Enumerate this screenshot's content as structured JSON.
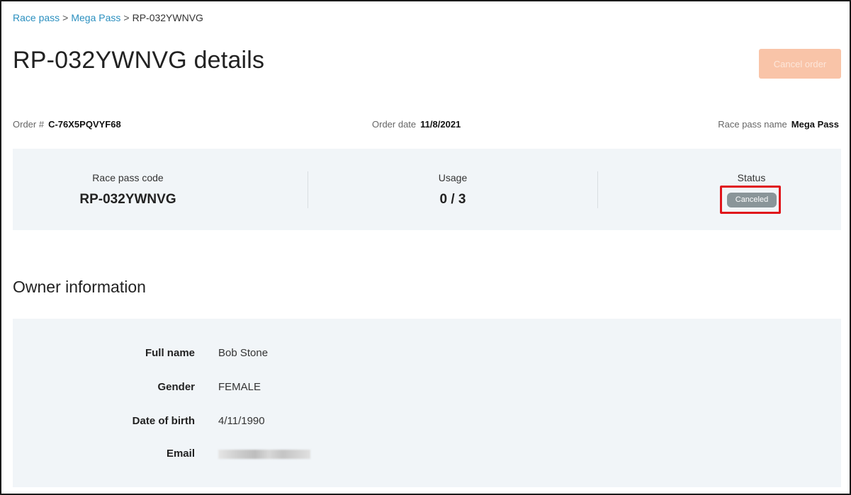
{
  "breadcrumb": {
    "items": [
      "Race pass",
      "Mega Pass"
    ],
    "current": "RP-032YWNVG",
    "separator": ">"
  },
  "page": {
    "title": "RP-032YWNVG details",
    "cancel_button": "Cancel order"
  },
  "meta": {
    "order_label": "Order #",
    "order_value": "C-76X5PQVYF68",
    "date_label": "Order date",
    "date_value": "11/8/2021",
    "pass_label": "Race pass name",
    "pass_value": "Mega Pass"
  },
  "summary": {
    "code_label": "Race pass code",
    "code_value": "RP-032YWNVG",
    "usage_label": "Usage",
    "usage_value": "0 / 3",
    "status_label": "Status",
    "status_value": "Canceled"
  },
  "owner": {
    "section_title": "Owner information",
    "fields": [
      {
        "label": "Full name",
        "value": "Bob Stone"
      },
      {
        "label": "Gender",
        "value": "FEMALE"
      },
      {
        "label": "Date of birth",
        "value": "4/11/1990"
      },
      {
        "label": "Email",
        "value": ""
      }
    ]
  },
  "colors": {
    "link": "#2a8fbf",
    "accent_disabled": "#f9c4a8",
    "panel_bg": "#f1f5f8",
    "status_badge": "#8a9599",
    "highlight": "#e0141b"
  }
}
